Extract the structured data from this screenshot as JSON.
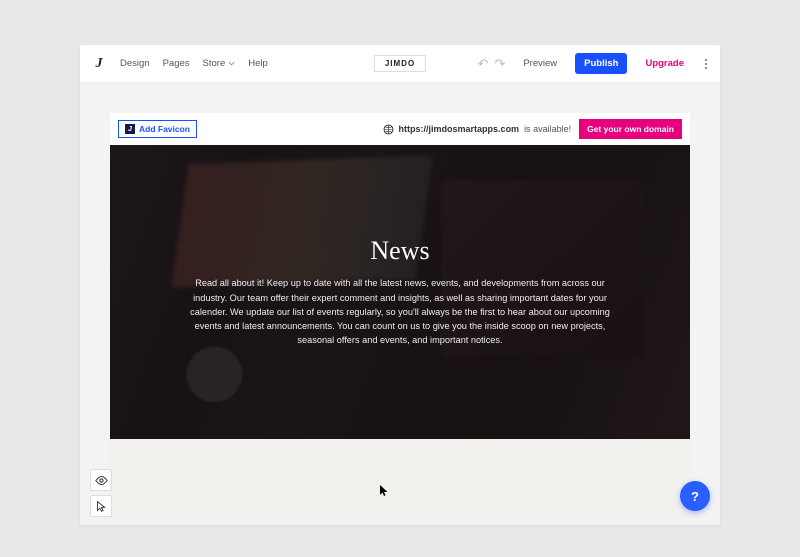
{
  "topbar": {
    "logo_glyph": "J",
    "nav": {
      "design": "Design",
      "pages": "Pages",
      "store": "Store",
      "help": "Help"
    },
    "brand_label": "JIMDO",
    "preview_label": "Preview",
    "publish_label": "Publish",
    "upgrade_label": "Upgrade"
  },
  "notice": {
    "favicon_label": "Add Favicon",
    "domain_prefix": "https://jimdosmartapps.com",
    "domain_suffix": "is available!",
    "domain_cta": "Get your own domain"
  },
  "hero": {
    "title": "News",
    "body": "Read all about it! Keep up to date with all the latest news, events, and developments from across our industry. Our team offer their expert comment and insights, as well as sharing important dates for your calender. We update our list of events regularly, so you'll always be the first to hear about our upcoming events and latest announcements. You can count on us to give you the inside scoop on new projects, seasonal offers and events, and important notices."
  },
  "help": {
    "label": "?"
  }
}
